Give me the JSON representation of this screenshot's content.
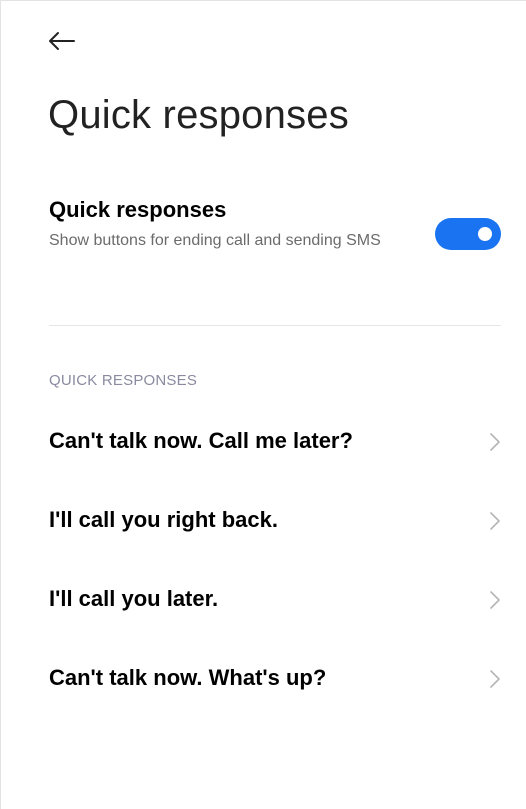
{
  "header": {
    "back_icon": "arrow-left-icon",
    "title": "Quick responses"
  },
  "toggle": {
    "title": "Quick responses",
    "subtitle": "Show buttons for ending call and sending SMS",
    "enabled": true,
    "accent_color": "#1a73f0"
  },
  "section": {
    "header": "QUICK RESPONSES"
  },
  "responses": [
    {
      "label": "Can't talk now. Call me later?"
    },
    {
      "label": "I'll call you right back."
    },
    {
      "label": "I'll call you later."
    },
    {
      "label": "Can't talk now. What's up?"
    }
  ]
}
